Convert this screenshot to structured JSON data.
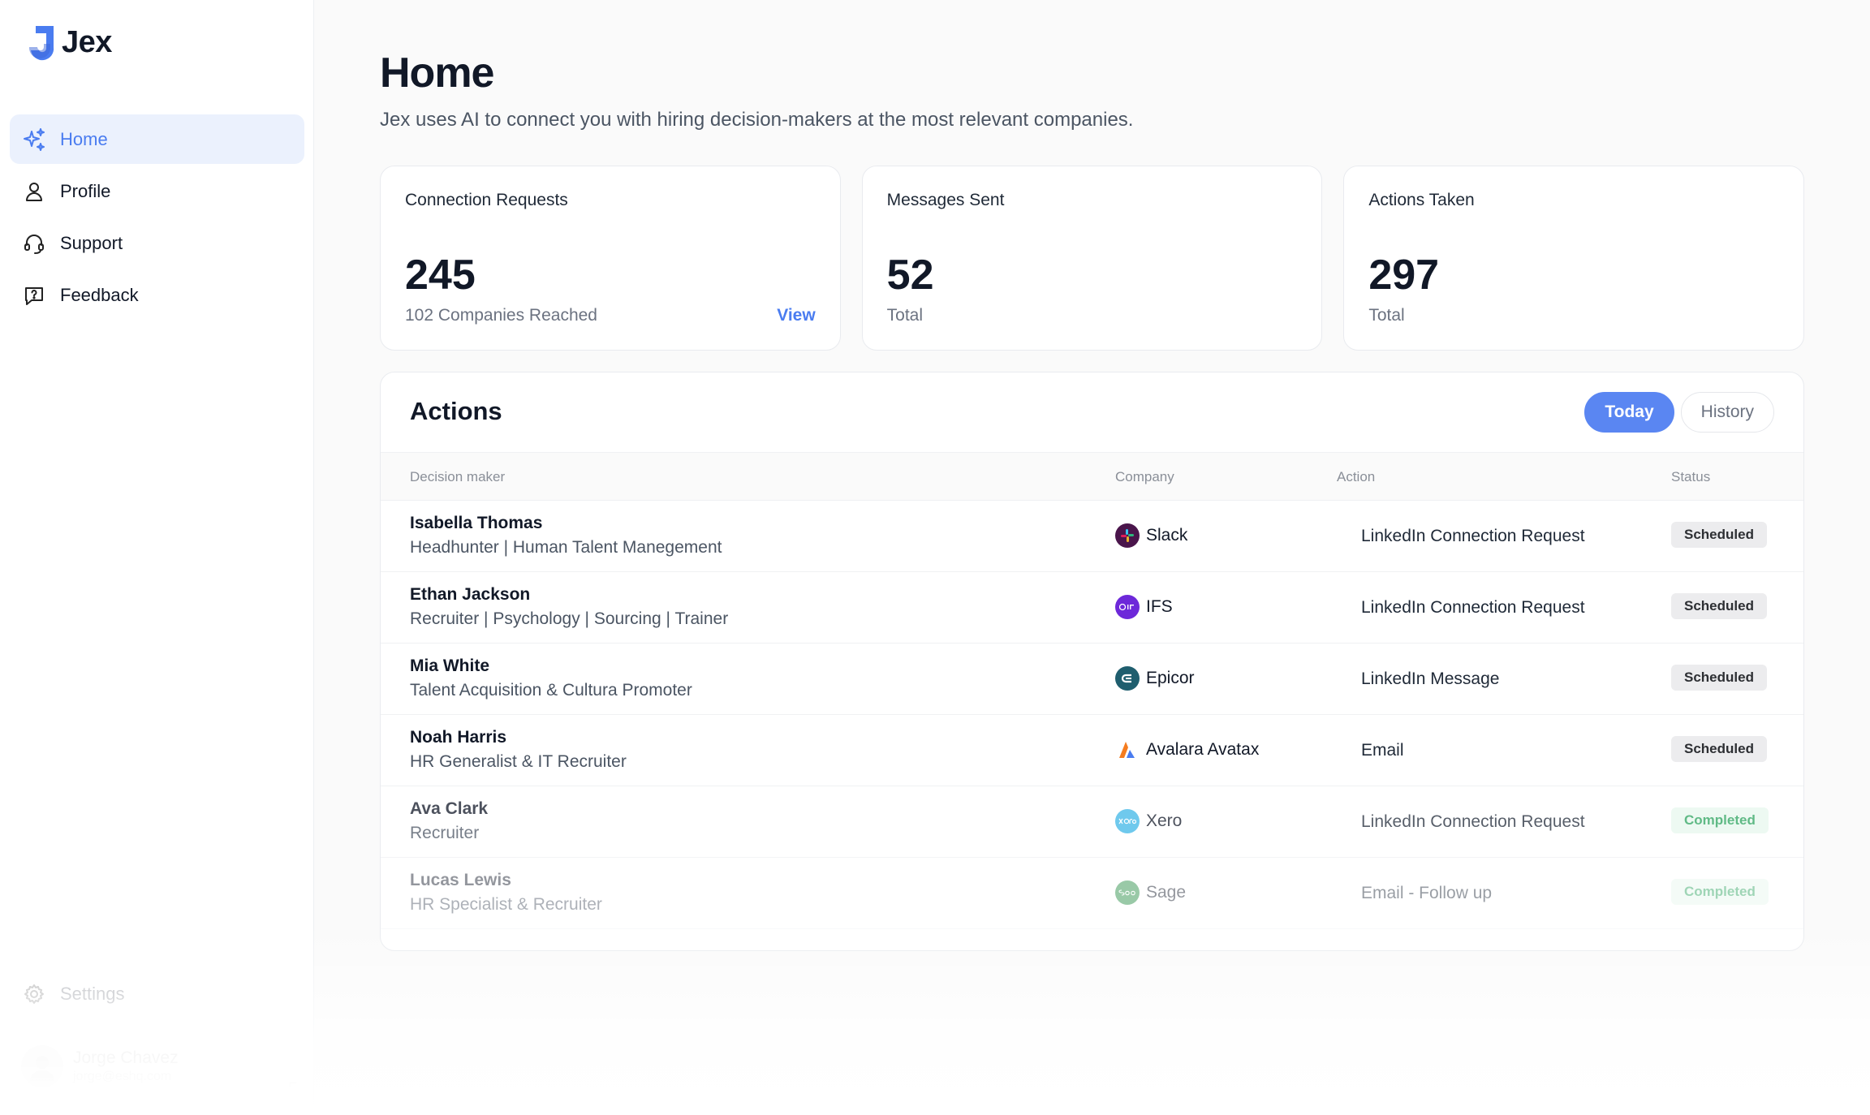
{
  "app": {
    "name": "Jex"
  },
  "sidebar": {
    "items": [
      {
        "label": "Home",
        "icon": "sparkles-icon",
        "active": true
      },
      {
        "label": "Profile",
        "icon": "user-icon"
      },
      {
        "label": "Support",
        "icon": "headset-icon"
      },
      {
        "label": "Feedback",
        "icon": "message-question-icon"
      }
    ],
    "settings_label": "Settings",
    "user": {
      "name": "Jorge Chavez",
      "email": "jorge@eshq.com"
    }
  },
  "header": {
    "title": "Home",
    "subtitle": "Jex uses AI to connect you with hiring decision-makers at the most relevant companies."
  },
  "stats": [
    {
      "title": "Connection Requests",
      "value": "245",
      "sub": "102 Companies Reached",
      "link": "View"
    },
    {
      "title": "Messages Sent",
      "value": "52",
      "sub": "Total"
    },
    {
      "title": "Actions Taken",
      "value": "297",
      "sub": "Total"
    }
  ],
  "actions": {
    "title": "Actions",
    "tabs": [
      "Today",
      "History"
    ],
    "columns": [
      "Decision maker",
      "Company",
      "Action",
      "Status"
    ],
    "rows": [
      {
        "name": "Isabella Thomas",
        "title": "Headhunter | Human Talent Manegement",
        "company": "Slack",
        "action": "LinkedIn Connection Request",
        "status": "Scheduled"
      },
      {
        "name": "Ethan Jackson",
        "title": "Recruiter | Psychology | Sourcing | Trainer",
        "company": "IFS",
        "action": "LinkedIn Connection Request",
        "status": "Scheduled"
      },
      {
        "name": "Mia White",
        "title": "Talent Acquisition & Cultura Promoter",
        "company": "Epicor",
        "action": "LinkedIn Message",
        "status": "Scheduled"
      },
      {
        "name": "Noah Harris",
        "title": "HR Generalist & IT Recruiter",
        "company": "Avalara Avatax",
        "action": "Email",
        "status": "Scheduled"
      },
      {
        "name": "Ava Clark",
        "title": "Recruiter",
        "company": "Xero",
        "action": "LinkedIn Connection Request",
        "status": "Completed"
      },
      {
        "name": "Lucas Lewis",
        "title": "HR Specialist & Recruiter",
        "company": "Sage",
        "action": "Email - Follow up",
        "status": "Completed"
      }
    ]
  },
  "colors": {
    "accent": "#4a7cf0",
    "active_bg": "#ebf1fd",
    "completed": "#2ca35e"
  }
}
